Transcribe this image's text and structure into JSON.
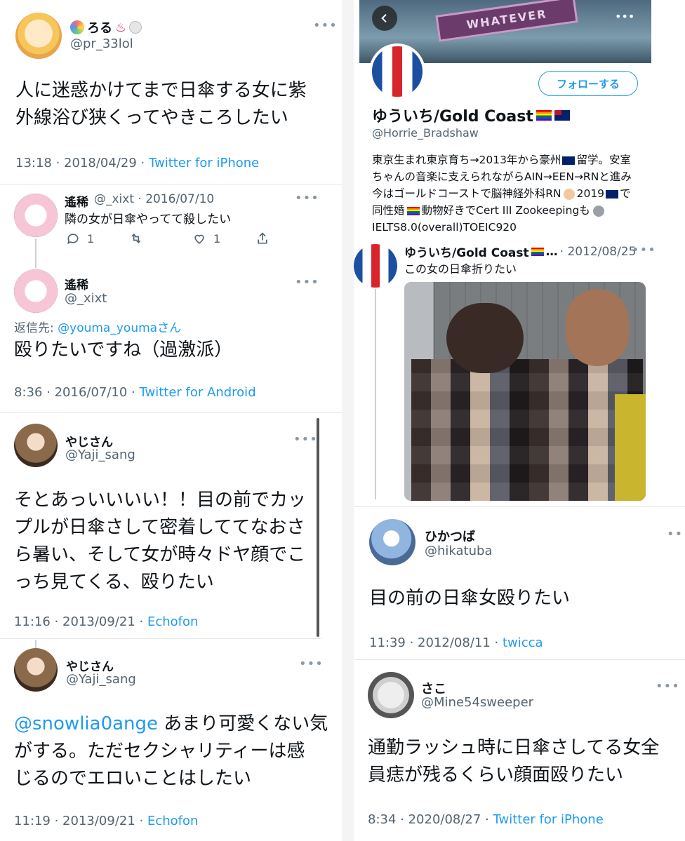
{
  "left": {
    "tweet1": {
      "name": "ろる",
      "emoji_after_name": "♨",
      "handle": "@pr_33lol",
      "text": "人に迷惑かけてまで日傘する女に紫外線浴び狭くってやきころしたい",
      "text_line1": "人に迷惑かけてまで日傘する女に紫",
      "text_line2": "外線浴び狭くってやきころしたい",
      "time": "13:18 · 2018/04/29 · ",
      "source": "Twitter for iPhone"
    },
    "tweet2": {
      "name": "遙稀",
      "handle_date": "@_xixt · 2016/07/10",
      "text": "隣の女が日傘やってて殺したい",
      "reply_count": "1",
      "like_count": "1"
    },
    "tweet3": {
      "name": "遙稀",
      "handle": "@_xixt",
      "reply_to_label": "返信先: ",
      "reply_to_user": "@youma_youmaさん",
      "text": "殴りたいですね（過激派）",
      "time": "8:36 · 2016/07/10 · ",
      "source": "Twitter for Android"
    },
    "tweet4": {
      "name": "やじさん",
      "handle": "@Yaji_sang",
      "line1": "そとあっいいいい！！目の前でカッ",
      "line2": "プルが日傘さして密着しててなおさ",
      "line3": "ら暑い、そして女が時々ドヤ顔でこ",
      "line4": "っち見てくる、殴りたい",
      "time": "11:16 · 2013/09/21 · ",
      "source": "Echofon"
    },
    "tweet5": {
      "name": "やじさん",
      "handle": "@Yaji_sang",
      "mention": "@snowlia0ange",
      "line1_rest": " あまり可愛くない気",
      "line2": "がする。ただセクシャリティーは感",
      "line3": "じるのでエロいことはしたい",
      "time": "11:19 · 2013/09/21 · ",
      "source": "Echofon"
    }
  },
  "right": {
    "profile": {
      "banner_sign": "WHATEVER",
      "follow_button": "フォローする",
      "name": "ゆういち/Gold Coast",
      "handle": "@Horrie_Bradshaw",
      "bio_line1": "東京生まれ東京育ち→2013年から豪州",
      "bio_line1b": "留学。安室",
      "bio_line2": "ちゃんの音楽に支えられながらAIN→EEN→RNと進み",
      "bio_line3": "今はゴールドコーストで脳神経外科RN",
      "bio_line3b": "2019",
      "bio_line3c": "で",
      "bio_line4": "同性婚",
      "bio_line4b": "動物好きでCert III Zookeepingも",
      "bio_line5": "IELTS8.0(overall)TOEIC920"
    },
    "tweet6": {
      "name": "ゆういち/Gold Coast",
      "ellipsis": "…",
      "date": "· 2012/08/25",
      "text": "この女の日傘折りたい"
    },
    "tweet7": {
      "name": "ひかつば",
      "handle": "@hikatuba",
      "text": "目の前の日傘女殴りたい",
      "time": "11:39 · 2012/08/11 · ",
      "source": "twicca"
    },
    "tweet8": {
      "name": "さこ",
      "handle": "@Mine54sweeper",
      "line1": "通勤ラッシュ時に日傘さしてる女全",
      "line2": "員痣が残るくらい顔面殴りたい",
      "time": "8:34 · 2020/08/27 · ",
      "source": "Twitter for iPhone"
    }
  },
  "icons": [
    "more-icon",
    "reply-icon",
    "retweet-icon",
    "like-icon",
    "share-icon",
    "back-icon",
    "rainbow-flag-icon",
    "australia-flag-icon"
  ],
  "colors": {
    "link": "#1d9bf0",
    "muted": "#536471",
    "text": "#0f1419"
  }
}
